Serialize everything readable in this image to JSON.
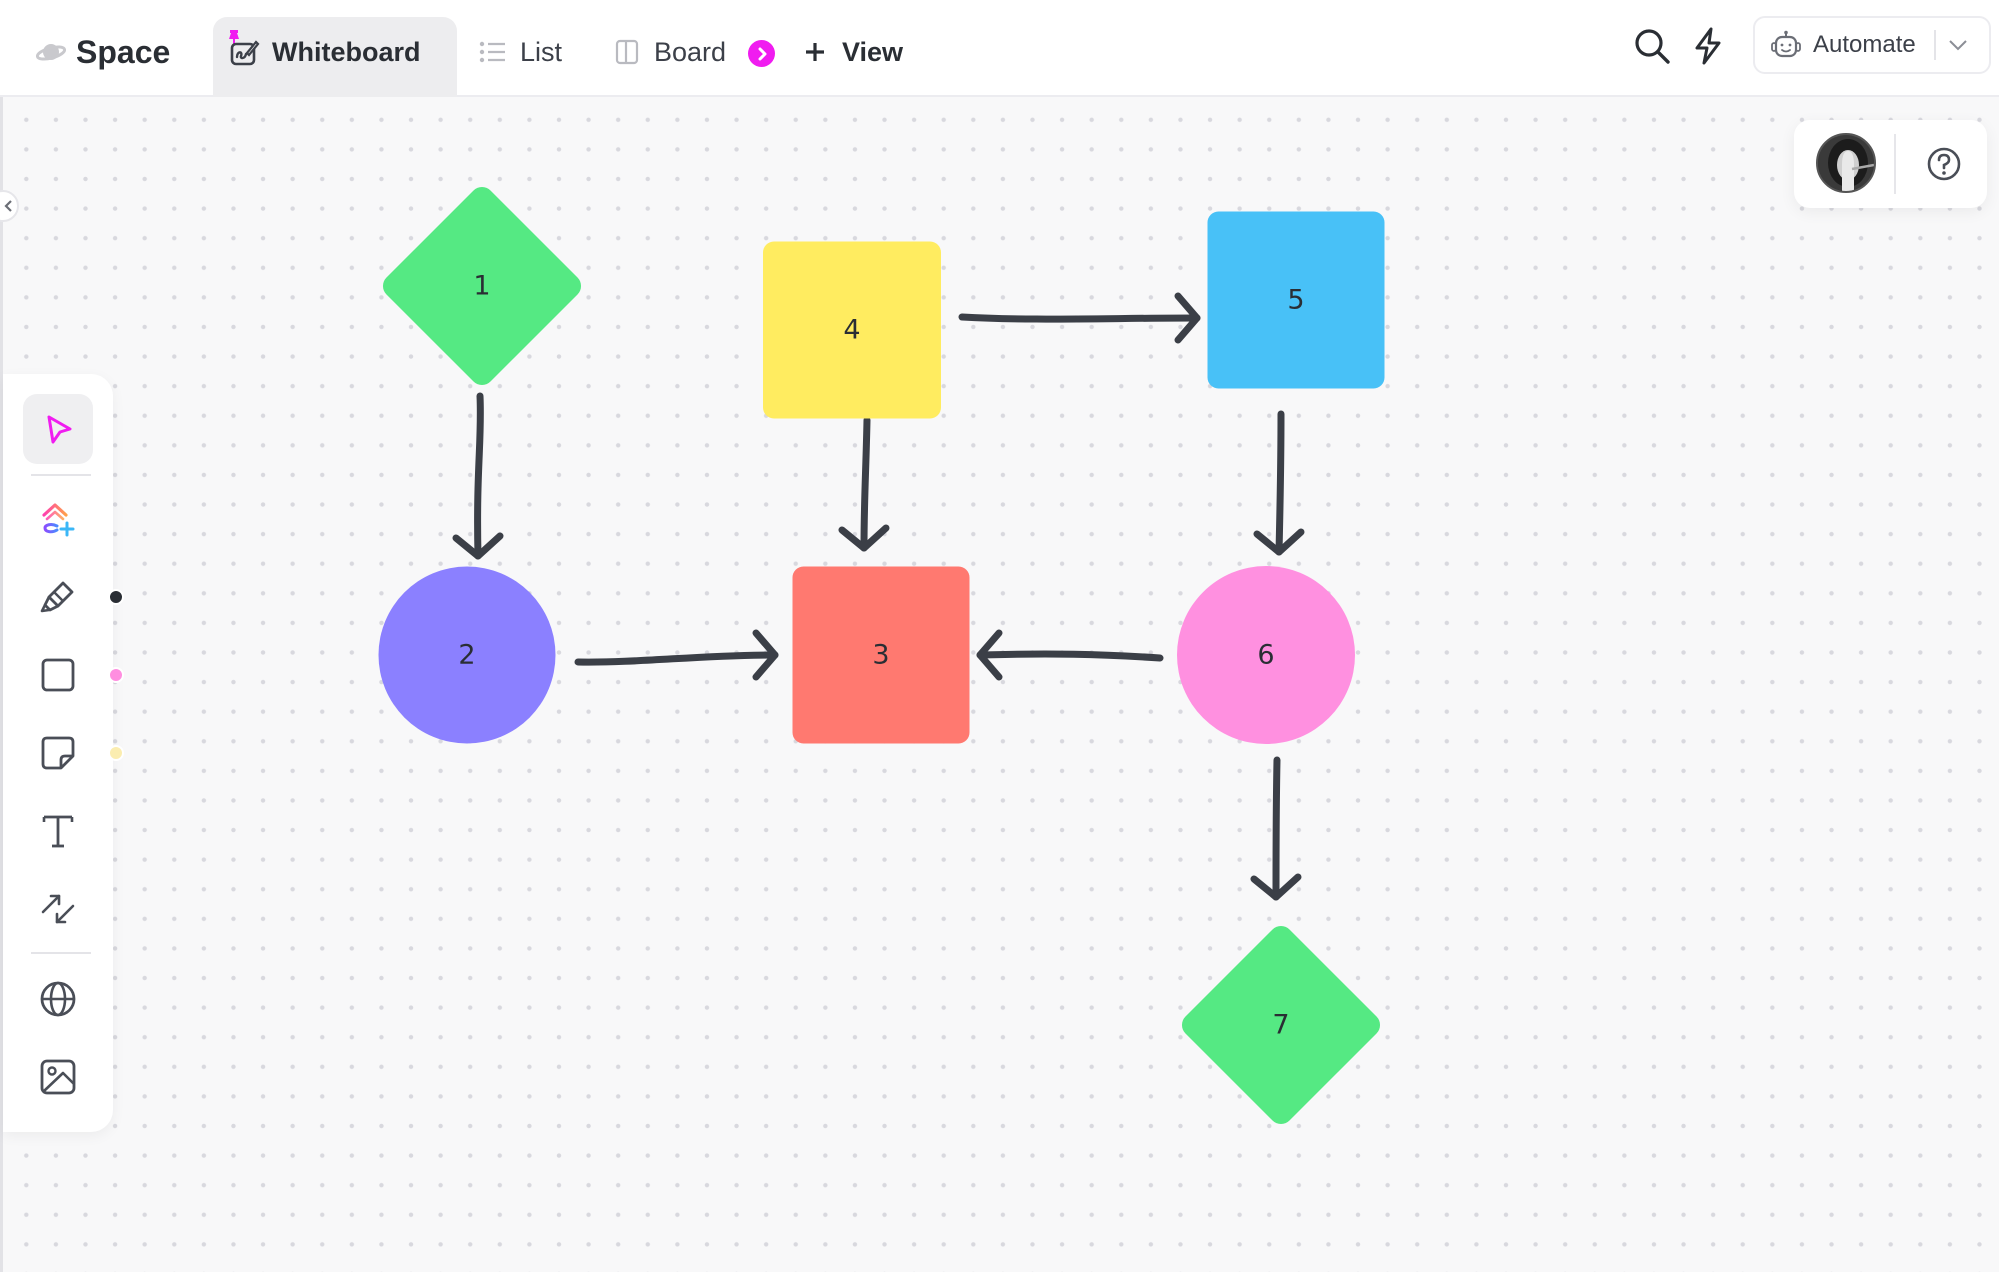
{
  "header": {
    "space_label": "Space",
    "tabs": [
      {
        "label": "Whiteboard",
        "icon": "whiteboard-icon",
        "active": true,
        "pinned": true
      },
      {
        "label": "List",
        "icon": "list-icon",
        "active": false
      },
      {
        "label": "Board",
        "icon": "board-icon",
        "active": false
      }
    ],
    "add_view_label": "View",
    "automate_label": "Automate",
    "icons": [
      "search-icon",
      "lightning-icon"
    ]
  },
  "toolbar": {
    "tools": [
      {
        "name": "select",
        "icon": "pointer-icon",
        "selected": true
      },
      {
        "name": "ai-generate",
        "icon": "clickup-ai-icon"
      },
      {
        "name": "pen",
        "icon": "pen-icon",
        "color": "#2a2e34"
      },
      {
        "name": "shape",
        "icon": "square-icon",
        "color": "#ff8ee0"
      },
      {
        "name": "sticky-note",
        "icon": "sticky-note-icon",
        "color": "#fbedb0"
      },
      {
        "name": "text",
        "icon": "text-icon"
      },
      {
        "name": "connector",
        "icon": "connector-icon"
      },
      {
        "name": "embed",
        "icon": "globe-icon"
      },
      {
        "name": "image",
        "icon": "image-icon"
      }
    ]
  },
  "accent_color": "#f01cf0",
  "diagram": {
    "nodes": [
      {
        "id": "1",
        "label": "1",
        "shape": "diamond",
        "color": "#55e983"
      },
      {
        "id": "2",
        "label": "2",
        "shape": "circle",
        "color": "#8b80ff"
      },
      {
        "id": "3",
        "label": "3",
        "shape": "square",
        "color": "#ff7970"
      },
      {
        "id": "4",
        "label": "4",
        "shape": "square",
        "color": "#ffec60"
      },
      {
        "id": "5",
        "label": "5",
        "shape": "square",
        "color": "#48c1f7"
      },
      {
        "id": "6",
        "label": "6",
        "shape": "circle",
        "color": "#ff90e0"
      },
      {
        "id": "7",
        "label": "7",
        "shape": "diamond",
        "color": "#55e983"
      }
    ],
    "edges": [
      {
        "from": "1",
        "to": "2"
      },
      {
        "from": "2",
        "to": "3"
      },
      {
        "from": "4",
        "to": "3"
      },
      {
        "from": "4",
        "to": "5"
      },
      {
        "from": "5",
        "to": "6"
      },
      {
        "from": "6",
        "to": "3"
      },
      {
        "from": "6",
        "to": "7"
      }
    ],
    "edge_color": "#3b3f47"
  }
}
